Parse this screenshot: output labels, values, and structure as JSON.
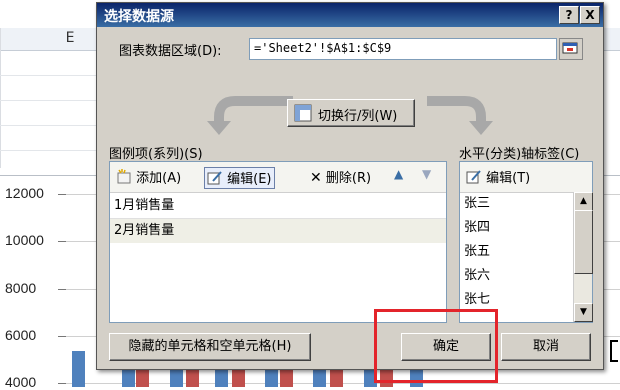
{
  "background": {
    "column_header": "E",
    "y_ticks": [
      "12000",
      "10000",
      "8000",
      "6000",
      "4000"
    ]
  },
  "dialog": {
    "title": "选择数据源",
    "help_button": "?",
    "close_button": "X",
    "range_label": "图表数据区域(D):",
    "range_value": "='Sheet2'!$A$1:$C$9",
    "switch_button": "切换行/列(W)",
    "legend_panel": {
      "label": "图例项(系列)(S)",
      "add_label": "添加(A)",
      "edit_label": "编辑(E)",
      "delete_label": "删除(R)",
      "items": [
        "1月销售量",
        "2月销售量"
      ],
      "selected_index": 1
    },
    "axis_panel": {
      "label": "水平(分类)轴标签(C)",
      "edit_label": "编辑(T)",
      "items": [
        "张三",
        "张四",
        "张五",
        "张六",
        "张七"
      ]
    },
    "hidden_cells_button": "隐藏的单元格和空单元格(H)",
    "ok_button": "确定",
    "cancel_button": "取消"
  },
  "colors": {
    "title_bar": "#0a246a",
    "dialog_face": "#d4d0c8",
    "series_blue": "#4f81bd",
    "series_red": "#c0504d",
    "highlight": "#e3242b"
  }
}
